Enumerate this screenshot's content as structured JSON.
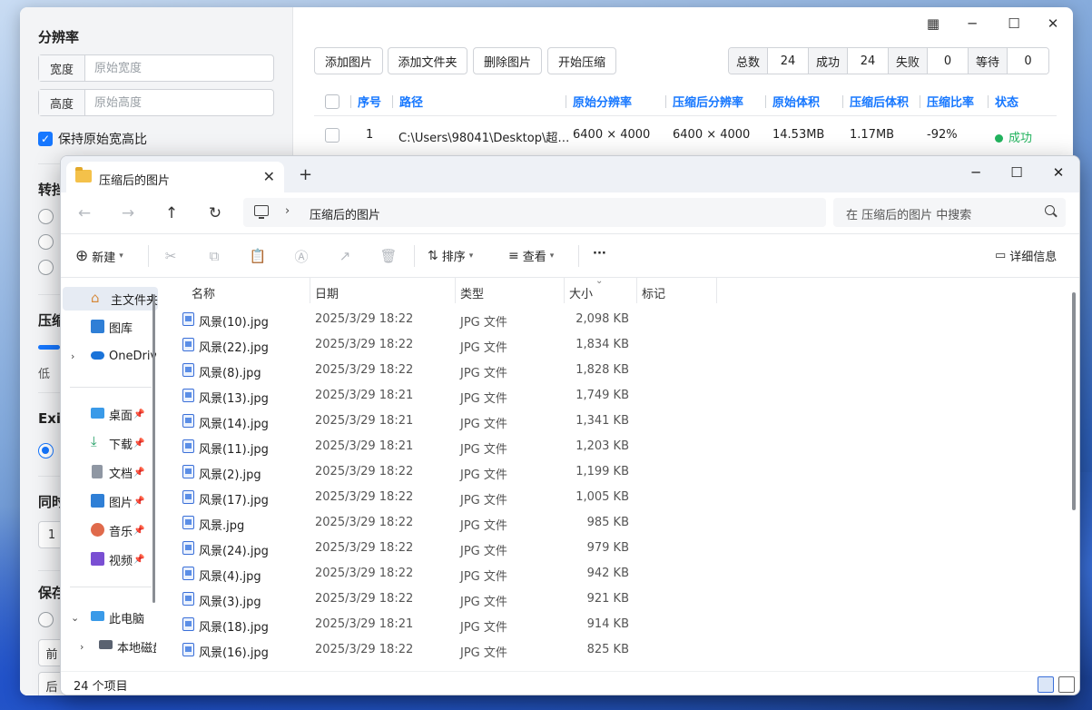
{
  "back_app": {
    "resolution_title": "分辨率",
    "width_label": "宽度",
    "width_placeholder": "原始宽度",
    "height_label": "高度",
    "height_placeholder": "原始高度",
    "keep_ratio_label": "保持原始宽高比",
    "convert_title_partial": "转挡",
    "compress_title_partial": "压缩",
    "low_label": "低",
    "exif_title_partial": "Exif",
    "same_title_partial": "同时",
    "num_box_value": "1",
    "save_title_partial": "保存",
    "front_btn_partial": "前",
    "back_btn_partial": "后",
    "toolbar": {
      "add_image": "添加图片",
      "add_folder": "添加文件夹",
      "delete_image": "删除图片",
      "start_compress": "开始压缩"
    },
    "stats": {
      "total_label": "总数",
      "total_value": "24",
      "success_label": "成功",
      "success_value": "24",
      "fail_label": "失败",
      "fail_value": "0",
      "wait_label": "等待",
      "wait_value": "0"
    },
    "table_headers": [
      "序号",
      "路径",
      "原始分辨率",
      "压缩后分辨率",
      "原始体积",
      "压缩后体积",
      "压缩比率",
      "状态"
    ],
    "row1": {
      "index": "1",
      "path": "C:\\Users\\98041\\Desktop\\超…",
      "orig_res": "6400 × 4000",
      "new_res": "6400 × 4000",
      "orig_size": "14.53MB",
      "new_size": "1.17MB",
      "ratio": "-92%",
      "status": "成功",
      "status_color": "#22b35e"
    }
  },
  "explorer": {
    "tab_title": "压缩后的图片",
    "breadcrumb": "压缩后的图片",
    "search_placeholder": "在 压缩后的图片 中搜索",
    "cmd": {
      "new": "新建",
      "sort": "排序",
      "view": "查看",
      "more": "···",
      "details": "详细信息"
    },
    "sidebar": {
      "home": "主文件夹",
      "gallery": "图库",
      "onedrive": "OneDrive",
      "desktop": "桌面",
      "downloads": "下载",
      "documents": "文档",
      "pictures": "图片",
      "music": "音乐",
      "videos": "视频",
      "this_pc": "此电脑",
      "local_disk": "本地磁盘"
    },
    "columns": [
      "名称",
      "日期",
      "类型",
      "大小",
      "标记"
    ],
    "files": [
      {
        "name": "风景(10).jpg",
        "date": "2025/3/29 18:22",
        "type": "JPG 文件",
        "size": "2,098 KB"
      },
      {
        "name": "风景(22).jpg",
        "date": "2025/3/29 18:22",
        "type": "JPG 文件",
        "size": "1,834 KB"
      },
      {
        "name": "风景(8).jpg",
        "date": "2025/3/29 18:22",
        "type": "JPG 文件",
        "size": "1,828 KB"
      },
      {
        "name": "风景(13).jpg",
        "date": "2025/3/29 18:21",
        "type": "JPG 文件",
        "size": "1,749 KB"
      },
      {
        "name": "风景(14).jpg",
        "date": "2025/3/29 18:21",
        "type": "JPG 文件",
        "size": "1,341 KB"
      },
      {
        "name": "风景(11).jpg",
        "date": "2025/3/29 18:21",
        "type": "JPG 文件",
        "size": "1,203 KB"
      },
      {
        "name": "风景(2).jpg",
        "date": "2025/3/29 18:22",
        "type": "JPG 文件",
        "size": "1,199 KB"
      },
      {
        "name": "风景(17).jpg",
        "date": "2025/3/29 18:22",
        "type": "JPG 文件",
        "size": "1,005 KB"
      },
      {
        "name": "风景.jpg",
        "date": "2025/3/29 18:22",
        "type": "JPG 文件",
        "size": "985 KB"
      },
      {
        "name": "风景(24).jpg",
        "date": "2025/3/29 18:22",
        "type": "JPG 文件",
        "size": "979 KB"
      },
      {
        "name": "风景(4).jpg",
        "date": "2025/3/29 18:22",
        "type": "JPG 文件",
        "size": "942 KB"
      },
      {
        "name": "风景(3).jpg",
        "date": "2025/3/29 18:22",
        "type": "JPG 文件",
        "size": "921 KB"
      },
      {
        "name": "风景(18).jpg",
        "date": "2025/3/29 18:21",
        "type": "JPG 文件",
        "size": "914 KB"
      },
      {
        "name": "风景(16).jpg",
        "date": "2025/3/29 18:22",
        "type": "JPG 文件",
        "size": "825 KB"
      }
    ],
    "item_count": "24 个项目"
  }
}
